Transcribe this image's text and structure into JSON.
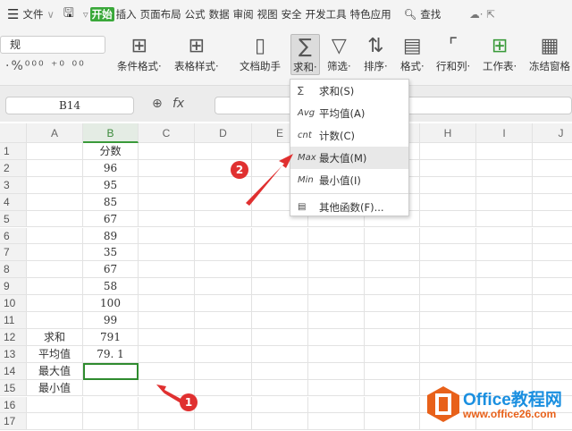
{
  "menubar": {
    "items": [
      "文件",
      "开始",
      "插入",
      "页面布局",
      "公式",
      "数据",
      "审阅",
      "视图",
      "安全",
      "开发工具",
      "特色应用"
    ],
    "search": "查找"
  },
  "ribbon": {
    "numfmt": "规",
    "buttons": [
      "条件格式·",
      "表格样式·",
      "文档助手",
      "求和·",
      "筛选·",
      "排序·",
      "格式·",
      "行和列·",
      "工作表·",
      "冻结窗格"
    ]
  },
  "formula_bar": {
    "name_box": "B14",
    "fx": "fx"
  },
  "grid": {
    "columns": [
      "A",
      "B",
      "C",
      "D",
      "E",
      "F",
      "G",
      "H",
      "I",
      "J"
    ],
    "rows": [
      [
        "",
        "分数"
      ],
      [
        "",
        "96"
      ],
      [
        "",
        "95"
      ],
      [
        "",
        "85"
      ],
      [
        "",
        "67"
      ],
      [
        "",
        "89"
      ],
      [
        "",
        "35"
      ],
      [
        "",
        "67"
      ],
      [
        "",
        "58"
      ],
      [
        "",
        "100"
      ],
      [
        "",
        "99"
      ],
      [
        "求和",
        "791"
      ],
      [
        "平均值",
        "79. 1"
      ],
      [
        "最大值",
        ""
      ],
      [
        "最小值",
        ""
      ],
      [
        "",
        ""
      ],
      [
        "",
        ""
      ]
    ],
    "selected": "B14"
  },
  "dropdown": {
    "items": [
      {
        "icon": "∑",
        "label": "求和(S)"
      },
      {
        "icon": "Avg",
        "label": "平均值(A)"
      },
      {
        "icon": "cnt",
        "label": "计数(C)"
      },
      {
        "icon": "Max",
        "label": "最大值(M)"
      },
      {
        "icon": "Min",
        "label": "最小值(I)"
      },
      {
        "icon": "▤",
        "label": "其他函数(F)..."
      }
    ]
  },
  "annotations": [
    "1",
    "2"
  ],
  "logo": {
    "title": "Office教程网",
    "url": "www.office26.com"
  }
}
